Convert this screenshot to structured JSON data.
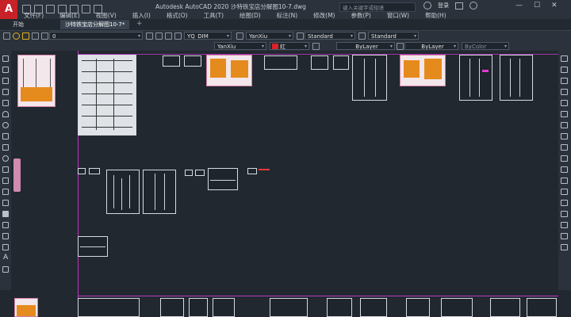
{
  "app": {
    "logo_letter": "A",
    "title": "Autodesk AutoCAD 2020    沙特铁宝店分解图10-7.dwg",
    "search_placeholder": "键入关键字或短语",
    "login_label": "登录"
  },
  "menu": [
    "文件(F)",
    "编辑(E)",
    "视图(V)",
    "插入(I)",
    "格式(O)",
    "工具(T)",
    "绘图(D)",
    "标注(N)",
    "修改(M)",
    "参数(P)",
    "窗口(W)",
    "帮助(H)"
  ],
  "tabs": [
    {
      "label": "开始",
      "active": false
    },
    {
      "label": "沙特铁宝店分解图10-7*",
      "active": true
    }
  ],
  "toolbar1": {
    "layer_value": "0",
    "dim_style": "YQ_DIM",
    "text_style": "YanXiu",
    "table_style": "Standard",
    "multileader_style": "Standard"
  },
  "toolbar2": {
    "layer_name": "YanXiu",
    "color_label": "红",
    "linetype": "ByLayer",
    "lineweight": "ByLayer",
    "plot_style": "ByColor"
  },
  "colors": {
    "accent_magenta": "#c037c0",
    "red": "#d8232a",
    "orange": "#e58b1d"
  }
}
